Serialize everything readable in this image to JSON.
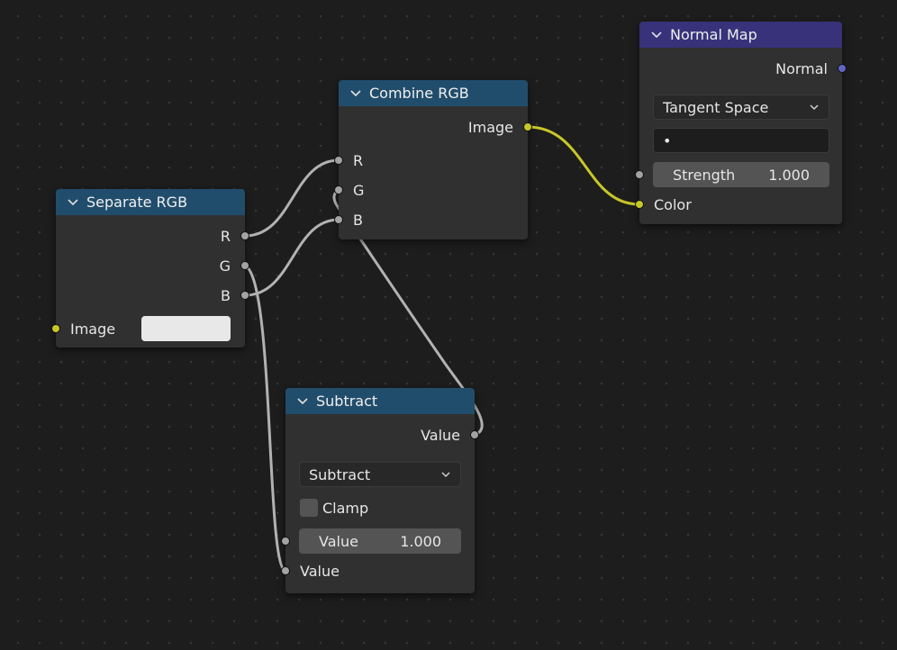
{
  "nodes": {
    "separate_rgb": {
      "title": "Separate RGB",
      "outputs": [
        "R",
        "G",
        "B"
      ],
      "input_label": "Image"
    },
    "combine_rgb": {
      "title": "Combine RGB",
      "output_label": "Image",
      "inputs": [
        "R",
        "G",
        "B"
      ]
    },
    "normal_map": {
      "title": "Normal Map",
      "output_label": "Normal",
      "space_value": "Tangent Space",
      "uv_map_value": "•",
      "strength_label": "Strength",
      "strength_value": "1.000",
      "color_label": "Color"
    },
    "subtract": {
      "title": "Subtract",
      "output_label": "Value",
      "operation_value": "Subtract",
      "clamp_label": "Clamp",
      "value1_label": "Value",
      "value1_value": "1.000",
      "value2_label": "Value"
    }
  },
  "icons": {
    "collapse": "chevron-down-icon",
    "dropdown": "chevron-down-icon"
  },
  "colors": {
    "header_blue": "#214d6c",
    "header_purple": "#37327a",
    "socket_grey": "#a3a3a3",
    "socket_yellow": "#c7c729",
    "socket_purple": "#6363c7",
    "link_grey": "#b2b2b2",
    "link_yellow": "#c7c729"
  }
}
